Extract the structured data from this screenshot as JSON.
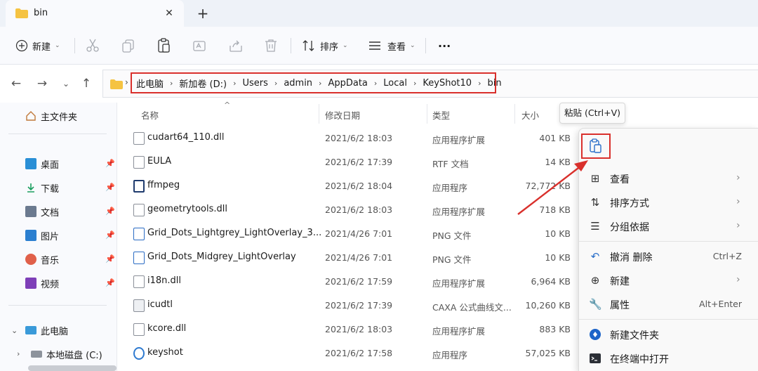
{
  "tab": {
    "title": "bin",
    "close": "✕",
    "add": "+"
  },
  "toolbar": {
    "new_label": "新建",
    "sort_label": "排序",
    "view_label": "查看",
    "more": "···"
  },
  "address": {
    "crumbs": [
      "此电脑",
      "新加卷 (D:)",
      "Users",
      "admin",
      "AppData",
      "Local",
      "KeyShot10",
      "bin"
    ]
  },
  "sidebar": {
    "home": "主文件夹",
    "quick": [
      {
        "label": "桌面",
        "color": "#2a8fd6"
      },
      {
        "label": "下载",
        "color": "#1a9e5f"
      },
      {
        "label": "文档",
        "color": "#6b7a8f"
      },
      {
        "label": "图片",
        "color": "#2b7fd0"
      },
      {
        "label": "音乐",
        "color": "#e0604a"
      },
      {
        "label": "视频",
        "color": "#7e3fb8"
      }
    ],
    "this_pc": "此电脑",
    "local_disk": "本地磁盘 (C:)"
  },
  "columns": {
    "name": "名称",
    "date": "修改日期",
    "type": "类型",
    "size": "大小"
  },
  "files": [
    {
      "name": "cudart64_110.dll",
      "date": "2021/6/2 18:03",
      "type": "应用程序扩展",
      "size": "401 KB"
    },
    {
      "name": "EULA",
      "date": "2021/6/2 17:39",
      "type": "RTF 文档",
      "size": "14 KB"
    },
    {
      "name": "ffmpeg",
      "date": "2021/6/2 18:04",
      "type": "应用程序",
      "size": "72,772 KB"
    },
    {
      "name": "geometrytools.dll",
      "date": "2021/6/2 18:03",
      "type": "应用程序扩展",
      "size": "718 KB"
    },
    {
      "name": "Grid_Dots_Lightgrey_LightOverlay_3...",
      "date": "2021/4/26 7:01",
      "type": "PNG 文件",
      "size": "10 KB"
    },
    {
      "name": "Grid_Dots_Midgrey_LightOverlay",
      "date": "2021/4/26 7:01",
      "type": "PNG 文件",
      "size": "10 KB"
    },
    {
      "name": "i18n.dll",
      "date": "2021/6/2 17:59",
      "type": "应用程序扩展",
      "size": "6,964 KB"
    },
    {
      "name": "icudtl",
      "date": "2021/6/2 17:39",
      "type": "CAXA 公式曲线文...",
      "size": "10,260 KB"
    },
    {
      "name": "kcore.dll",
      "date": "2021/6/2 18:03",
      "type": "应用程序扩展",
      "size": "883 KB"
    },
    {
      "name": "keyshot",
      "date": "2021/6/2 17:58",
      "type": "应用程序",
      "size": "57,025 KB"
    }
  ],
  "tooltip": "粘贴 (Ctrl+V)",
  "context_menu": {
    "view": "查看",
    "sort_by": "排序方式",
    "group_by": "分组依据",
    "undo": "撤消 删除",
    "undo_shortcut": "Ctrl+Z",
    "new": "新建",
    "properties": "属性",
    "properties_shortcut": "Alt+Enter",
    "new_folder": "新建文件夹",
    "open_terminal": "在终端中打开"
  },
  "colors": {
    "highlight": "#d9302c",
    "folder": "#f5c342"
  }
}
